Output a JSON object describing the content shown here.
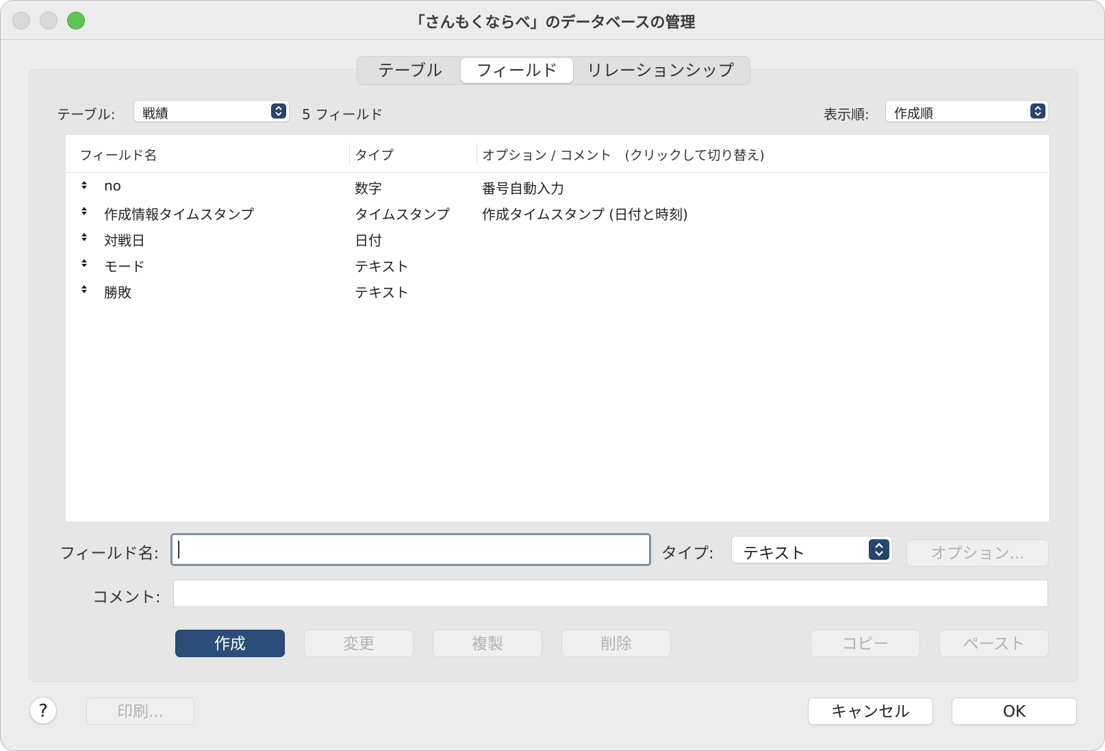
{
  "window": {
    "title": "「さんもくならべ」のデータベースの管理"
  },
  "tabs": [
    {
      "label": "テーブル",
      "selected": false
    },
    {
      "label": "フィールド",
      "selected": true
    },
    {
      "label": "リレーションシップ",
      "selected": false
    }
  ],
  "toolbar": {
    "table_label": "テーブル:",
    "table_value": "戦績",
    "field_count": "5 フィールド",
    "sort_label": "表示順:",
    "sort_value": "作成順"
  },
  "table": {
    "headers": [
      "フィールド名",
      "タイプ",
      "オプション / コメント　(クリックして切り替え)"
    ],
    "rows": [
      {
        "name": "no",
        "type": "数字",
        "options": "番号自動入力"
      },
      {
        "name": "作成情報タイムスタンプ",
        "type": "タイムスタンプ",
        "options": "作成タイムスタンプ (日付と時刻)"
      },
      {
        "name": "対戦日",
        "type": "日付",
        "options": ""
      },
      {
        "name": "モード",
        "type": "テキスト",
        "options": ""
      },
      {
        "name": "勝敗",
        "type": "テキスト",
        "options": ""
      }
    ]
  },
  "form": {
    "field_name_label": "フィールド名:",
    "field_name_value": "",
    "type_label": "タイプ:",
    "type_value": "テキスト",
    "options_button": "オプション...",
    "comment_label": "コメント:",
    "comment_value": ""
  },
  "actions": {
    "create": "作成",
    "change": "変更",
    "duplicate": "複製",
    "delete": "削除",
    "copy": "コピー",
    "paste": "ペースト"
  },
  "footer": {
    "help": "?",
    "print": "印刷...",
    "cancel": "キャンセル",
    "ok": "OK"
  },
  "colors": {
    "accent": "#2c4c7a",
    "window_bg": "#ececec",
    "panel_bg": "#e6e6e6",
    "disabled_text": "#b3b3b3"
  }
}
